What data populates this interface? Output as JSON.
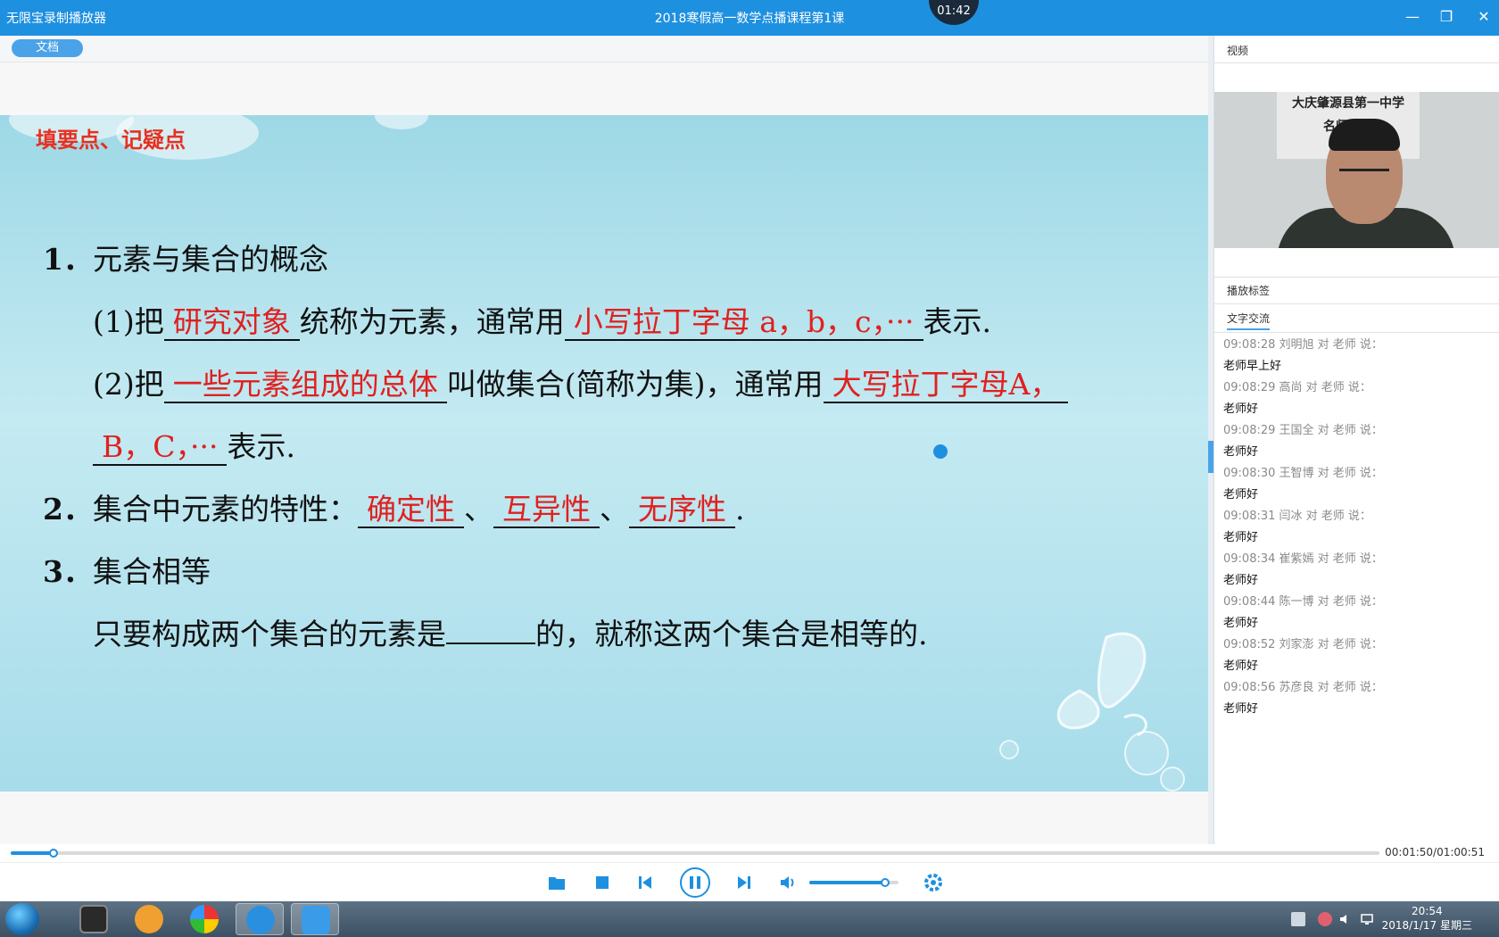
{
  "window": {
    "app_name": "无限宝录制播放器",
    "title": "2018寒假高一数学点播课程第1课",
    "timer": "01:42"
  },
  "document": {
    "tab_label": "文档",
    "slide": {
      "heading": "填要点、记疑点",
      "s1_num": "1．",
      "s1_title": "元素与集合的概念",
      "l1_a": "(1)把",
      "l1_ans1": "研究对象",
      "l1_b": "统称为元素，通常用",
      "l1_ans2": "小写拉丁字母 a，b，c，···",
      "l1_c": "表示.",
      "l2_a": "(2)把",
      "l2_ans1": "一些元素组成的总体",
      "l2_b": "叫做集合(简称为集)，通常用",
      "l2_ans2": "大写拉丁字母A，",
      "l3_ans": "B，C，···",
      "l3_b": "表示.",
      "s2_num": "2．",
      "s2_text": "集合中元素的特性：",
      "s2_ans1": "确定性",
      "s2_sep1": "、",
      "s2_ans2": "互异性",
      "s2_sep2": "、",
      "s2_ans3": "无序性",
      "s2_end": ".",
      "s3_num": "3．",
      "s3_title": "集合相等",
      "s3_text_a": "只要构成两个集合的元素是",
      "s3_text_b": "的，就称这两个集合是相等的."
    }
  },
  "right_panel": {
    "video_title": "视频",
    "video_banner_line1": "大庆肇源县第一中学",
    "video_banner_line2": "名师课堂",
    "bookmarks_title": "播放标签",
    "chat_tab": "文字交流",
    "chat": [
      {
        "meta": "09:08:28 刘明旭  对  老师  说：",
        "text": "老师早上好"
      },
      {
        "meta": "09:08:29 高尚  对  老师  说：",
        "text": "老师好"
      },
      {
        "meta": "09:08:29 王国全  对  老师  说：",
        "text": "老师好"
      },
      {
        "meta": "09:08:30 王智博  对  老师  说：",
        "text": "老师好"
      },
      {
        "meta": "09:08:31 闫冰  对  老师  说：",
        "text": "老师好"
      },
      {
        "meta": "09:08:34 崔紫嫣  对  老师  说：",
        "text": "老师好"
      },
      {
        "meta": "09:08:44 陈一博  对  老师  说：",
        "text": "老师好"
      },
      {
        "meta": "09:08:52 刘家澎  对  老师  说：",
        "text": "老师好"
      },
      {
        "meta": "09:08:56 苏彦良  对  老师  说：",
        "text": "老师好"
      }
    ]
  },
  "player": {
    "time_display": "00:01:50/01:00:51",
    "progress_fraction": 0.031,
    "volume_fraction": 0.85
  },
  "taskbar": {
    "clock_time": "20:54",
    "clock_date": "2018/1/17 星期三"
  },
  "colors": {
    "accent": "#1e90e0",
    "answer_red": "#e02020",
    "heading_red": "#e83020"
  },
  "icons": [
    "open-folder-icon",
    "stop-icon",
    "previous-icon",
    "pause-icon",
    "next-icon",
    "volume-icon",
    "settings-icon",
    "minimize-icon",
    "restore-icon",
    "close-icon"
  ]
}
